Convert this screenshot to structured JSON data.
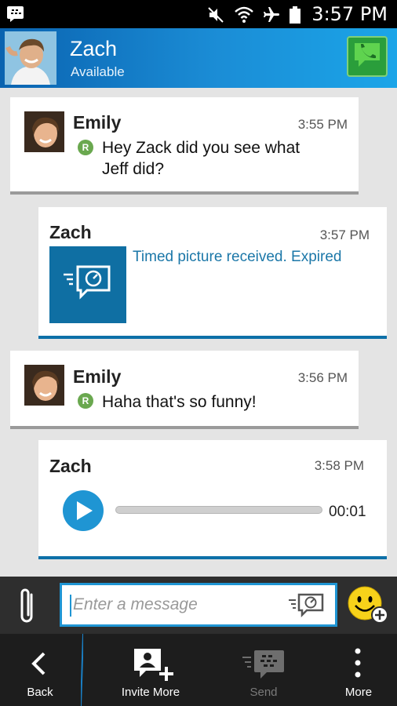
{
  "status_bar": {
    "time": "3:57 PM",
    "icons": [
      "bbm-notification-icon",
      "mute-icon",
      "wifi-icon",
      "airplane-icon",
      "battery-icon"
    ]
  },
  "header": {
    "contact_name": "Zach",
    "contact_status": "Available",
    "call_icon": "phone-chat-icon"
  },
  "messages": [
    {
      "sender": "Emily",
      "time": "3:55 PM",
      "text_line1": "Hey Zack did you see what",
      "text_line2": "Jeff did?",
      "read_badge": "R"
    },
    {
      "sender": "Zach",
      "time": "3:57 PM",
      "text": "Timed picture received. Expired"
    },
    {
      "sender": "Emily",
      "time": "3:56 PM",
      "text": "Haha that's so funny!",
      "read_badge": "R"
    },
    {
      "sender": "Zach",
      "time": "3:58 PM",
      "duration": "00:01",
      "progress": 0
    }
  ],
  "composer": {
    "placeholder": "Enter a message"
  },
  "actions": {
    "back": "Back",
    "invite_more": "Invite More",
    "send": "Send",
    "more": "More"
  },
  "colors": {
    "header_start": "#0a63b0",
    "header_end": "#1ba5e8",
    "accent": "#1f95d3",
    "timed_text": "#1b77a8",
    "read_badge": "#6aa84f",
    "call_button": "#2a9e3b"
  }
}
